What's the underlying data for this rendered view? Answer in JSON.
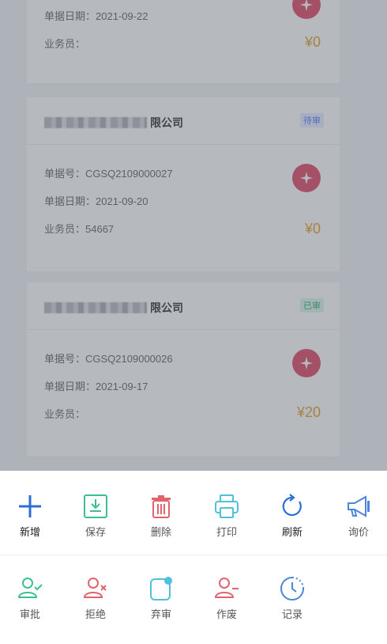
{
  "cards": [
    {
      "date_label": "单据日期：",
      "date": "2021-09-22",
      "staff_label": "业务员：",
      "staff": "",
      "amount": "¥0"
    },
    {
      "company_suffix": "限公司",
      "status": "待审",
      "no_label": "单据号：",
      "no": "CGSQ2109000027",
      "date_label": "单据日期：",
      "date": "2021-09-20",
      "staff_label": "业务员：",
      "staff": "54667",
      "amount": "¥0"
    },
    {
      "company_suffix": "限公司",
      "status": "已审",
      "no_label": "单据号：",
      "no": "CGSQ2109000026",
      "date_label": "单据日期：",
      "date": "2021-09-17",
      "staff_label": "业务员：",
      "staff": "",
      "amount": "¥20"
    }
  ],
  "actions_row1": [
    {
      "label": "新增",
      "icon": "plus-icon",
      "color": "#2b6fd6"
    },
    {
      "label": "保存",
      "icon": "save-icon",
      "color": "#3fbf8f"
    },
    {
      "label": "删除",
      "icon": "trash-icon",
      "color": "#e06470"
    },
    {
      "label": "打印",
      "icon": "printer-icon",
      "color": "#4fc1dc"
    },
    {
      "label": "刷新",
      "icon": "refresh-icon",
      "color": "#2b6fd6"
    },
    {
      "label": "询价",
      "icon": "megaphone-icon",
      "color": "#4a86d9"
    }
  ],
  "actions_row2": [
    {
      "label": "审批",
      "icon": "user-check-icon",
      "color": "#3fbf8f"
    },
    {
      "label": "拒绝",
      "icon": "user-x-icon",
      "color": "#e06470"
    },
    {
      "label": "弃审",
      "icon": "abandon-review-icon",
      "color": "#4fc1dc"
    },
    {
      "label": "作废",
      "icon": "user-minus-icon",
      "color": "#e06470"
    },
    {
      "label": "记录",
      "icon": "clock-icon",
      "color": "#4a86d9"
    }
  ]
}
